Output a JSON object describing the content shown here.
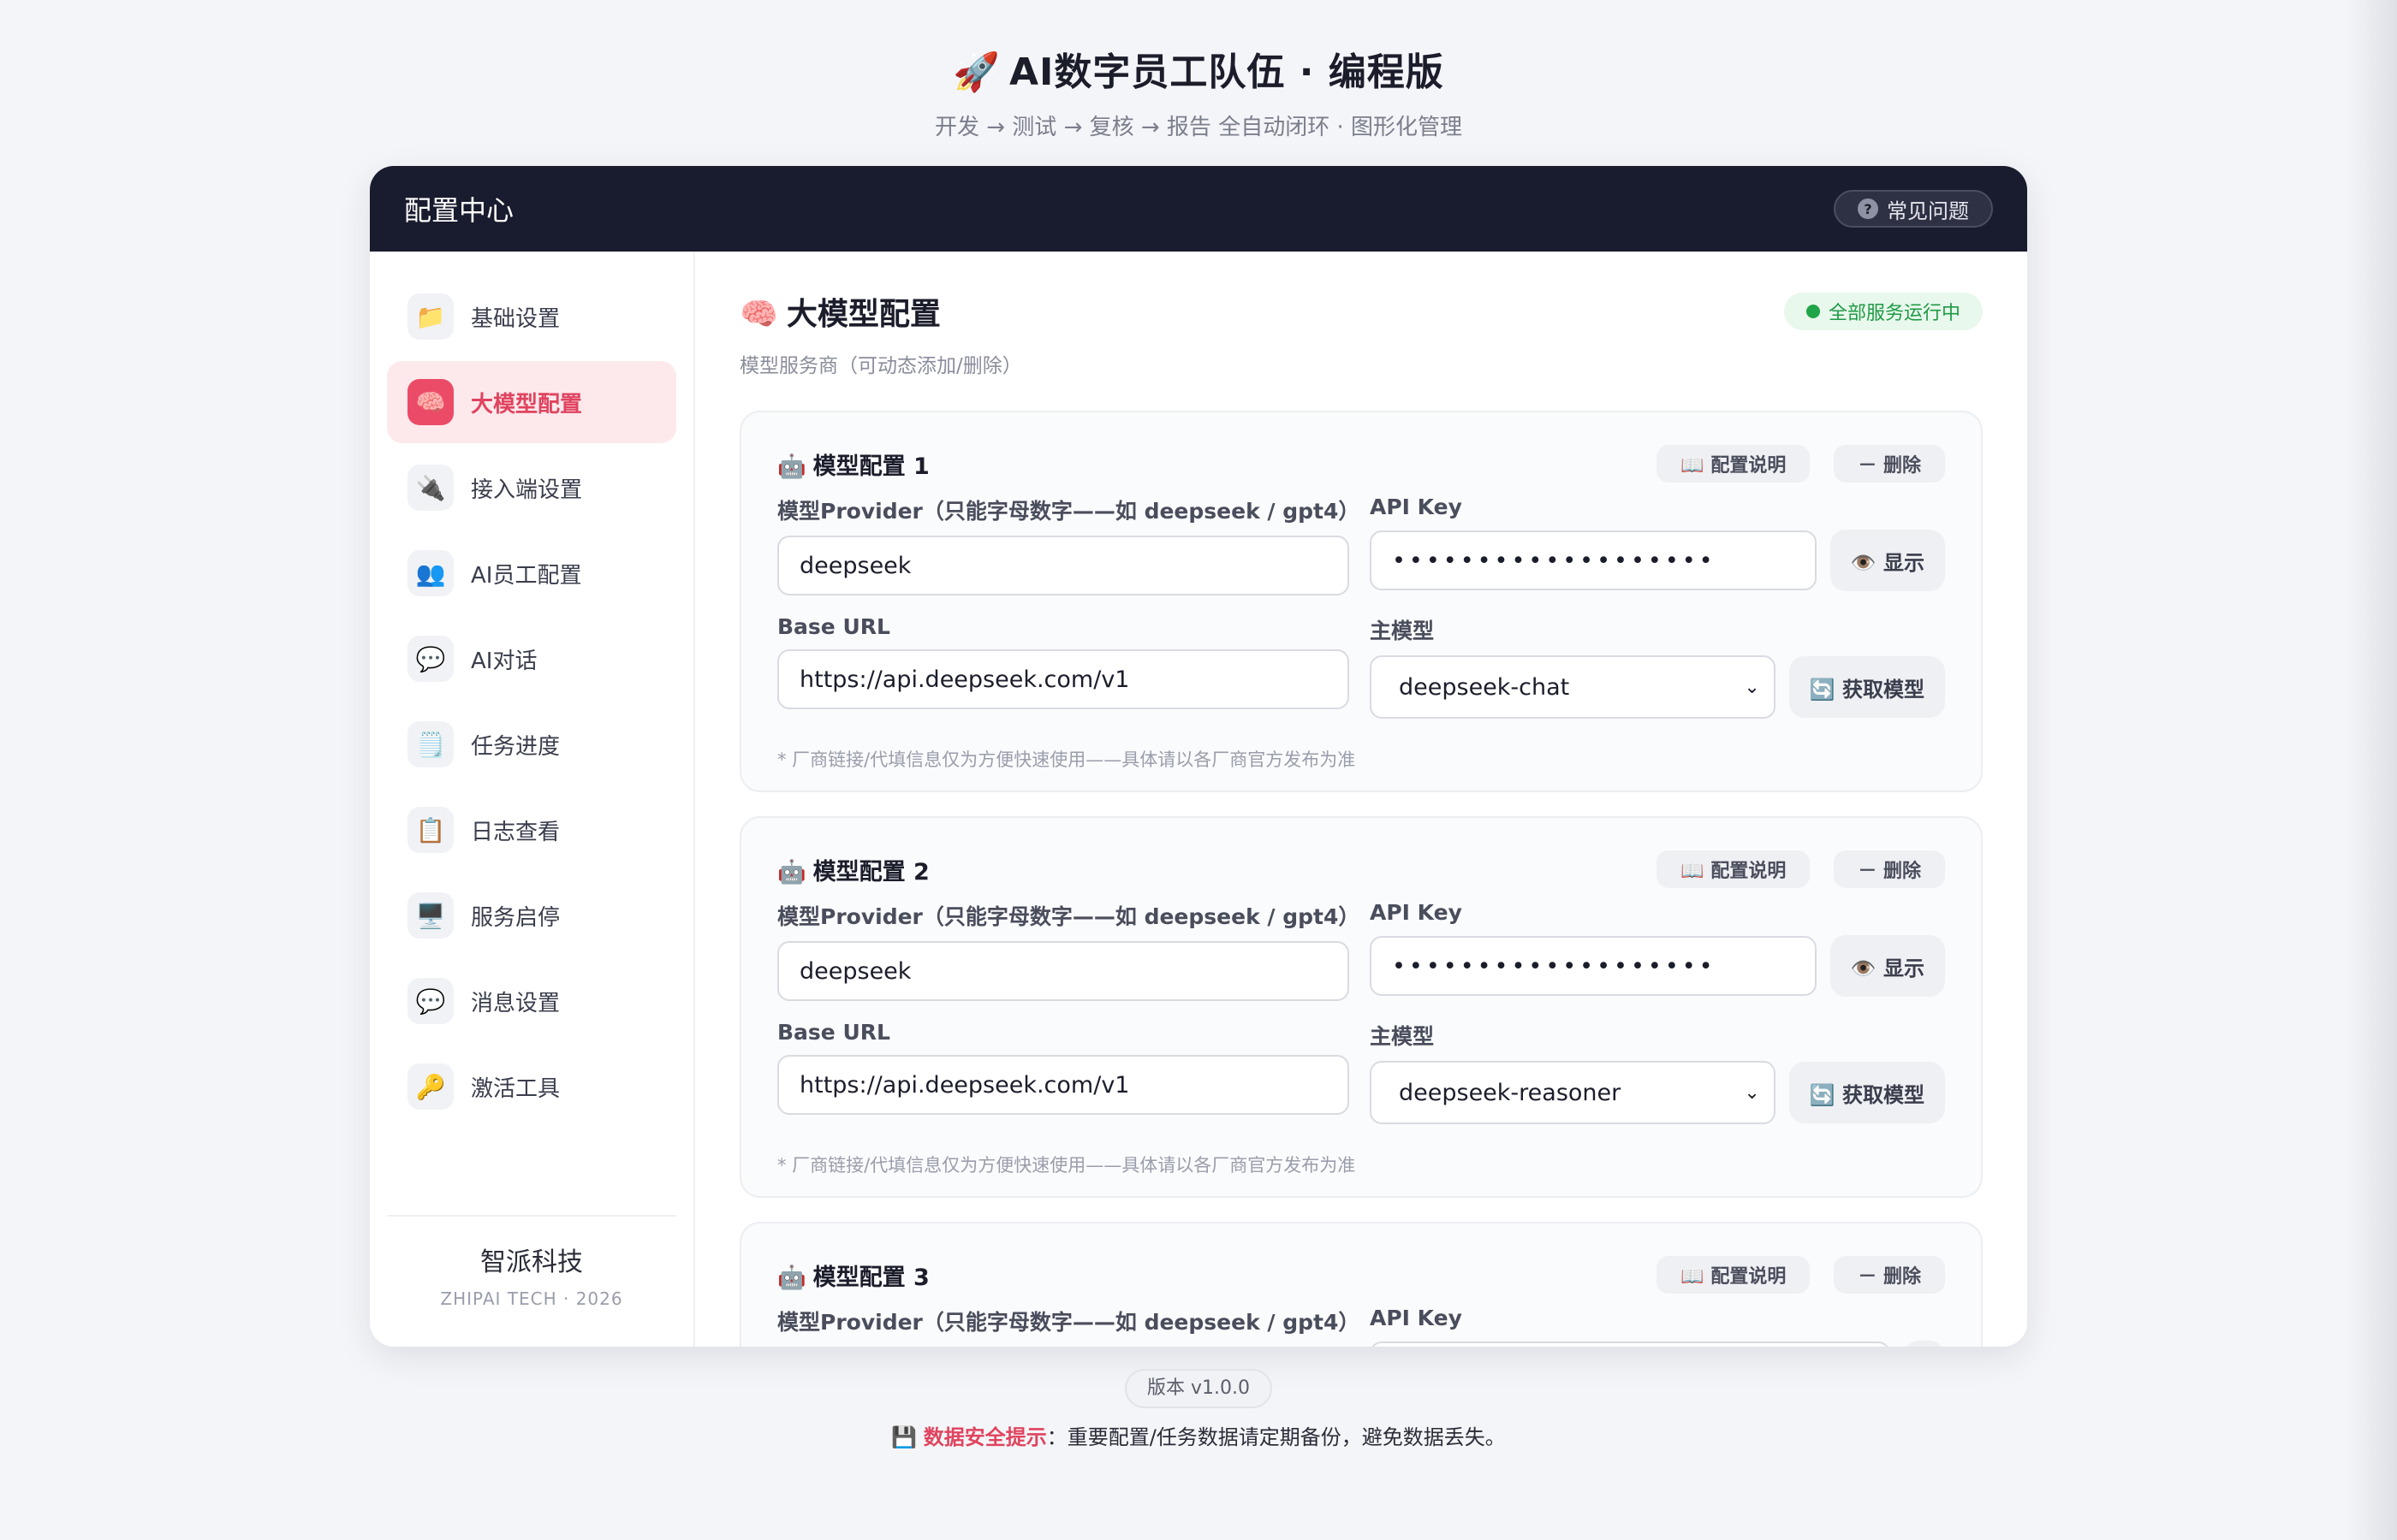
{
  "header": {
    "title_icon": "🚀",
    "title": "AI数字员工队伍 · 编程版",
    "subtitle": "开发 → 测试 → 复核 → 报告 全自动闭环 · 图形化管理"
  },
  "card_header": {
    "title": "配置中心",
    "faq_label": "常见问题"
  },
  "sidebar": {
    "items": [
      {
        "icon": "📁",
        "label": "基础设置"
      },
      {
        "icon": "🧠",
        "label": "大模型配置"
      },
      {
        "icon": "🔌",
        "label": "接入端设置"
      },
      {
        "icon": "👥",
        "label": "AI员工配置"
      },
      {
        "icon": "💬",
        "label": "AI对话"
      },
      {
        "icon": "🗒️",
        "label": "任务进度"
      },
      {
        "icon": "📋",
        "label": "日志查看"
      },
      {
        "icon": "🖥️",
        "label": "服务启停"
      },
      {
        "icon": "💬",
        "label": "消息设置"
      },
      {
        "icon": "🔑",
        "label": "激活工具"
      }
    ],
    "active_index": 1,
    "company": "智派科技",
    "company_sub": "ZHIPAI TECH · 2026"
  },
  "main": {
    "section_icon": "🧠",
    "section_title": "大模型配置",
    "section_sub": "模型服务商（可动态添加/删除）",
    "status_label": "全部服务运行中",
    "status_color": "#1fa548",
    "models": [
      {
        "icon": "🤖",
        "title": "模型配置 1",
        "doc_label": "📖 配置说明",
        "delete_label": "－ 删除",
        "provider_label": "模型Provider（只能字母数字——如 deepseek / gpt4）",
        "provider_value": "deepseek",
        "api_key_label": "API Key",
        "api_key_value": "•••••••••••••••••••",
        "show_label": "👁️ 显示",
        "base_url_label": "Base URL",
        "base_url_value": "https://api.deepseek.com/v1",
        "main_model_label": "主模型",
        "main_model_value": "deepseek-chat",
        "fetch_label": "🔄 获取模型",
        "note": "* 厂商链接/代填信息仅为方便快速使用——具体请以各厂商官方发布为准"
      },
      {
        "icon": "🤖",
        "title": "模型配置 2",
        "doc_label": "📖 配置说明",
        "delete_label": "－ 删除",
        "provider_label": "模型Provider（只能字母数字——如 deepseek / gpt4）",
        "provider_value": "deepseek",
        "api_key_label": "API Key",
        "api_key_value": "•••••••••••••••••••",
        "show_label": "👁️ 显示",
        "base_url_label": "Base URL",
        "base_url_value": "https://api.deepseek.com/v1",
        "main_model_label": "主模型",
        "main_model_value": "deepseek-reasoner",
        "fetch_label": "🔄 获取模型",
        "note": "* 厂商链接/代填信息仅为方便快速使用——具体请以各厂商官方发布为准"
      },
      {
        "icon": "🤖",
        "title": "模型配置 3",
        "doc_label": "📖 配置说明",
        "delete_label": "－ 删除",
        "provider_label": "模型Provider（只能字母数字——如 deepseek / gpt4）",
        "api_key_label": "API Key"
      }
    ]
  },
  "footer": {
    "version": "版本 v1.0.0",
    "tip_icon": "💾",
    "tip_highlight": "数据安全提示",
    "tip_text": "：重要配置/任务数据请定期备份，避免数据丢失。",
    "tip_color": "#e0445f"
  }
}
